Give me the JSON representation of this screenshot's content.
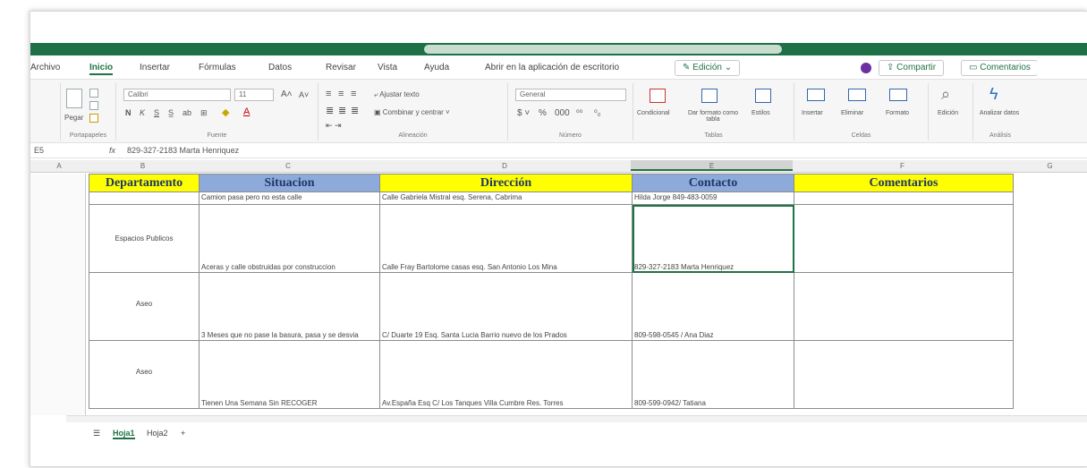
{
  "menu": {
    "tabs": [
      "Archivo",
      "Inicio",
      "Insertar",
      "Fórmulas",
      "Datos",
      "Revisar",
      "Vista",
      "Ayuda"
    ],
    "active_tab": "Inicio",
    "open_desktop": "Abrir en la aplicación de escritorio",
    "editing": "Edición",
    "share": "Compartir",
    "comments": "Comentarios"
  },
  "ribbon": {
    "paste": "Pegar",
    "clipboard_label": "Portapapeles",
    "font_name": "Calibri",
    "font_size": "11",
    "font_label": "Fuente",
    "wrap_text": "Ajustar texto",
    "merge_center": "Combinar y centrar",
    "alignment_label": "Alineación",
    "number_format": "General",
    "number_label": "Número",
    "conditional": "Condicional",
    "format_table": "Dar formato como tabla",
    "styles": "Estilos",
    "tables_label": "Tablas",
    "insert": "Insertar",
    "delete": "Eliminar",
    "format": "Formato",
    "cells_label": "Celdas",
    "edit": "Edición",
    "analyze": "Analizar datos",
    "analysis_label": "Análisis"
  },
  "formula_bar": {
    "cell_ref": "E5",
    "fx": "fx",
    "value": "829-327-2183 Marta Henriquez"
  },
  "columns": [
    "A",
    "B",
    "C",
    "D",
    "E",
    "F",
    "G"
  ],
  "headers": {
    "departamento": "Departamento",
    "situacion": "Situacion",
    "direccion": "Dirección",
    "contacto": "Contacto",
    "comentarios": "Comentarios"
  },
  "rows": [
    {
      "departamento": "",
      "situacion": "Camion pasa pero no esta calle",
      "direccion": "Calle Gabriela Mistral esq. Serena, Cabrima",
      "contacto": "Hilda Jorge 849-483-0059",
      "comentarios": ""
    },
    {
      "departamento": "Espacios Publicos",
      "situacion": "Aceras y calle obstruidas por construccion",
      "direccion": "Calle Fray Bartolome casas esq. San Antonio Los Mina",
      "contacto": "829-327-2183 Marta Henriquez",
      "comentarios": ""
    },
    {
      "departamento": "Aseo",
      "situacion": "3 Meses que no pase la basura, pasa y se desvia",
      "direccion": "C/ Duarte 19 Esq. Santa Lucia Barrio nuevo de los Prados",
      "contacto": "809-598-0545 / Ana Diaz",
      "comentarios": ""
    },
    {
      "departamento": "Aseo",
      "situacion": "Tienen Una Semana Sin RECOGER",
      "direccion": "Av.España Esq C/ Los Tanques Villa Cumbre Res. Torres",
      "contacto": "809-599-0942/ Tatiana",
      "comentarios": ""
    }
  ],
  "sheets": [
    "Hoja1",
    "Hoja2",
    "+"
  ],
  "colors": {
    "excel_green": "#217346",
    "yellow": "#ffff00",
    "blue_header": "#8eaadb"
  }
}
